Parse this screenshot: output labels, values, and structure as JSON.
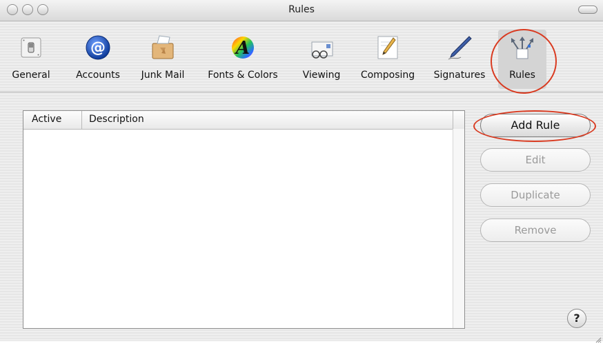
{
  "window": {
    "title": "Rules"
  },
  "toolbar": {
    "items": [
      {
        "label": "General",
        "icon": "light-switch-icon"
      },
      {
        "label": "Accounts",
        "icon": "at-sign-icon"
      },
      {
        "label": "Junk Mail",
        "icon": "junk-mail-icon"
      },
      {
        "label": "Fonts & Colors",
        "icon": "fonts-colors-icon"
      },
      {
        "label": "Viewing",
        "icon": "glasses-envelope-icon"
      },
      {
        "label": "Composing",
        "icon": "pencil-paper-icon"
      },
      {
        "label": "Signatures",
        "icon": "pen-icon"
      },
      {
        "label": "Rules",
        "icon": "rules-arrows-icon"
      }
    ],
    "selected": "Rules"
  },
  "rules_table": {
    "columns": [
      "Active",
      "Description"
    ],
    "rows": []
  },
  "buttons": {
    "add_rule": "Add Rule",
    "edit": "Edit",
    "duplicate": "Duplicate",
    "remove": "Remove",
    "help": "?"
  },
  "colors": {
    "highlight_circle": "#d93a20",
    "accounts_blue": "#1f57b8"
  }
}
